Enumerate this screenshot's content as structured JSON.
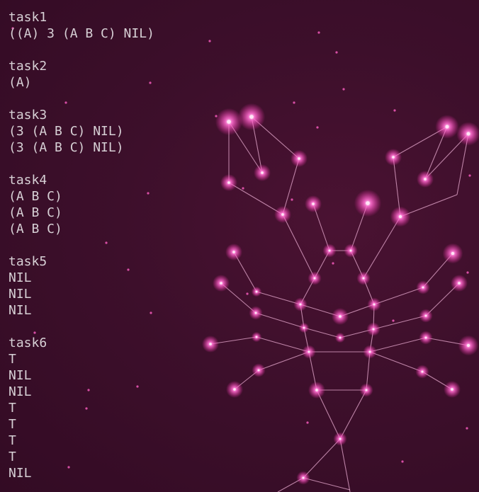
{
  "terminal": {
    "blocks": [
      {
        "label": "task1",
        "lines": [
          "((A) 3 (A B C) NIL)"
        ]
      },
      {
        "label": "task2",
        "lines": [
          "(A)"
        ]
      },
      {
        "label": "task3",
        "lines": [
          "(3 (A B C) NIL)",
          "(3 (A B C) NIL)"
        ]
      },
      {
        "label": "task4",
        "lines": [
          "(A B C)",
          "(A B C)",
          "(A B C)"
        ]
      },
      {
        "label": "task5",
        "lines": [
          "NIL",
          "NIL",
          "NIL"
        ]
      },
      {
        "label": "task6",
        "lines": [
          "T",
          "NIL",
          "NIL",
          "T",
          "T",
          "T",
          "T",
          "NIL"
        ]
      }
    ]
  },
  "theme": {
    "background": "#3d0f2b",
    "text": "#d7d0d5",
    "star": "#ff4fc0",
    "line": "#e7a9cf"
  },
  "wallpaper": {
    "icon": "lobster-constellation-icon"
  }
}
